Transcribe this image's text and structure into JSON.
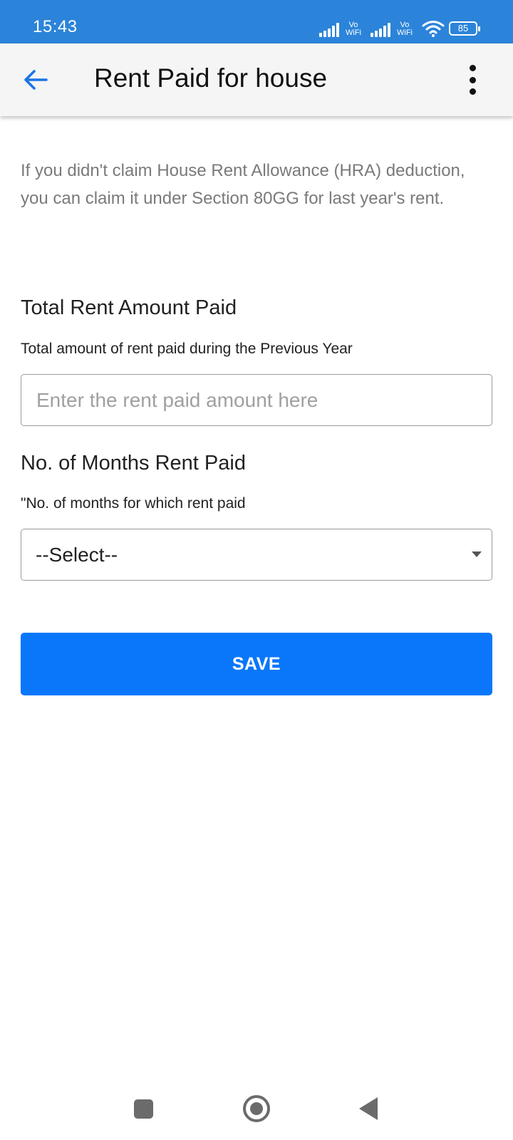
{
  "status_bar": {
    "time": "15:43",
    "vowifi_1": "Vo WiFi",
    "vowifi_2": "Vo WiFi",
    "battery": "85"
  },
  "app_bar": {
    "title": "Rent Paid for house",
    "back_icon": "arrow-left-icon",
    "menu_icon": "more-vert-icon",
    "accent_color": "#1a73e8"
  },
  "intro_text": "If you didn't claim House Rent Allowance (HRA) deduction, you can claim it under Section 80GG for last year's rent.",
  "rent_amount": {
    "title": "Total Rent Amount Paid",
    "subtitle": "Total amount of rent paid during the Previous Year",
    "placeholder": "Enter the rent paid amount here",
    "value": ""
  },
  "months": {
    "title": "No. of Months Rent Paid",
    "subtitle": "\"No. of months for which rent paid",
    "selected": "--Select--"
  },
  "save_label": "SAVE",
  "colors": {
    "status_bar": "#2b84d9",
    "primary_button": "#0a77fb",
    "app_bar_bg": "#f5f5f5"
  },
  "nav": {
    "recents_icon": "square-icon",
    "home_icon": "circle-icon",
    "back_icon": "triangle-back-icon"
  }
}
